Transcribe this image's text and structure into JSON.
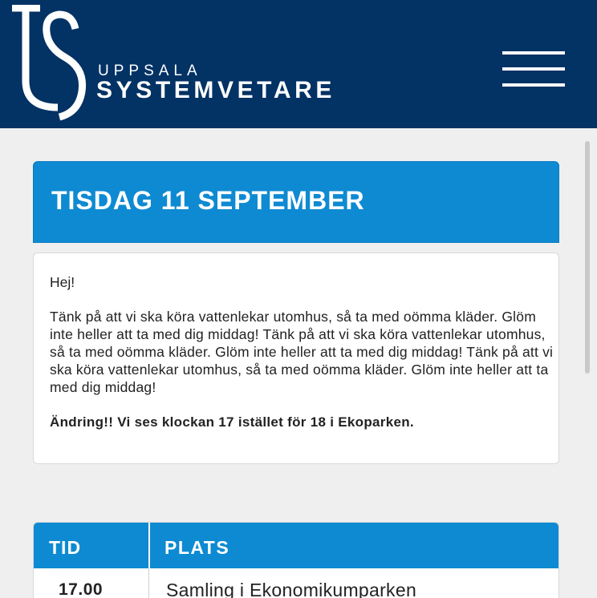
{
  "header": {
    "logo_small": "UPPSALA",
    "logo_big": "SYSTEMVETARE",
    "menu_icon": "hamburger-menu-icon",
    "background_color": "#033264"
  },
  "day": {
    "title": "TISDAG 11 SEPTEMBER",
    "accent_color": "#0e8ad2"
  },
  "info": {
    "greeting": "Hej!",
    "body": "Tänk på att vi ska köra vattenlekar utomhus, så ta med oömma kläder. Glöm inte heller att ta med dig middag! Tänk på att vi ska köra vattenlekar utomhus, så ta med oömma kläder. Glöm inte heller att ta med dig middag! Tänk på att vi ska köra vattenlekar utomhus, så ta med oömma kläder. Glöm inte heller att ta med dig middag!",
    "change_notice": "Ändring!! Vi ses klockan 17 istället för 18 i Ekoparken."
  },
  "schedule": {
    "columns": [
      "TID",
      "PLATS"
    ],
    "rows": [
      {
        "time": "17.00",
        "place": "Samling i Ekonomikumparken"
      }
    ]
  }
}
